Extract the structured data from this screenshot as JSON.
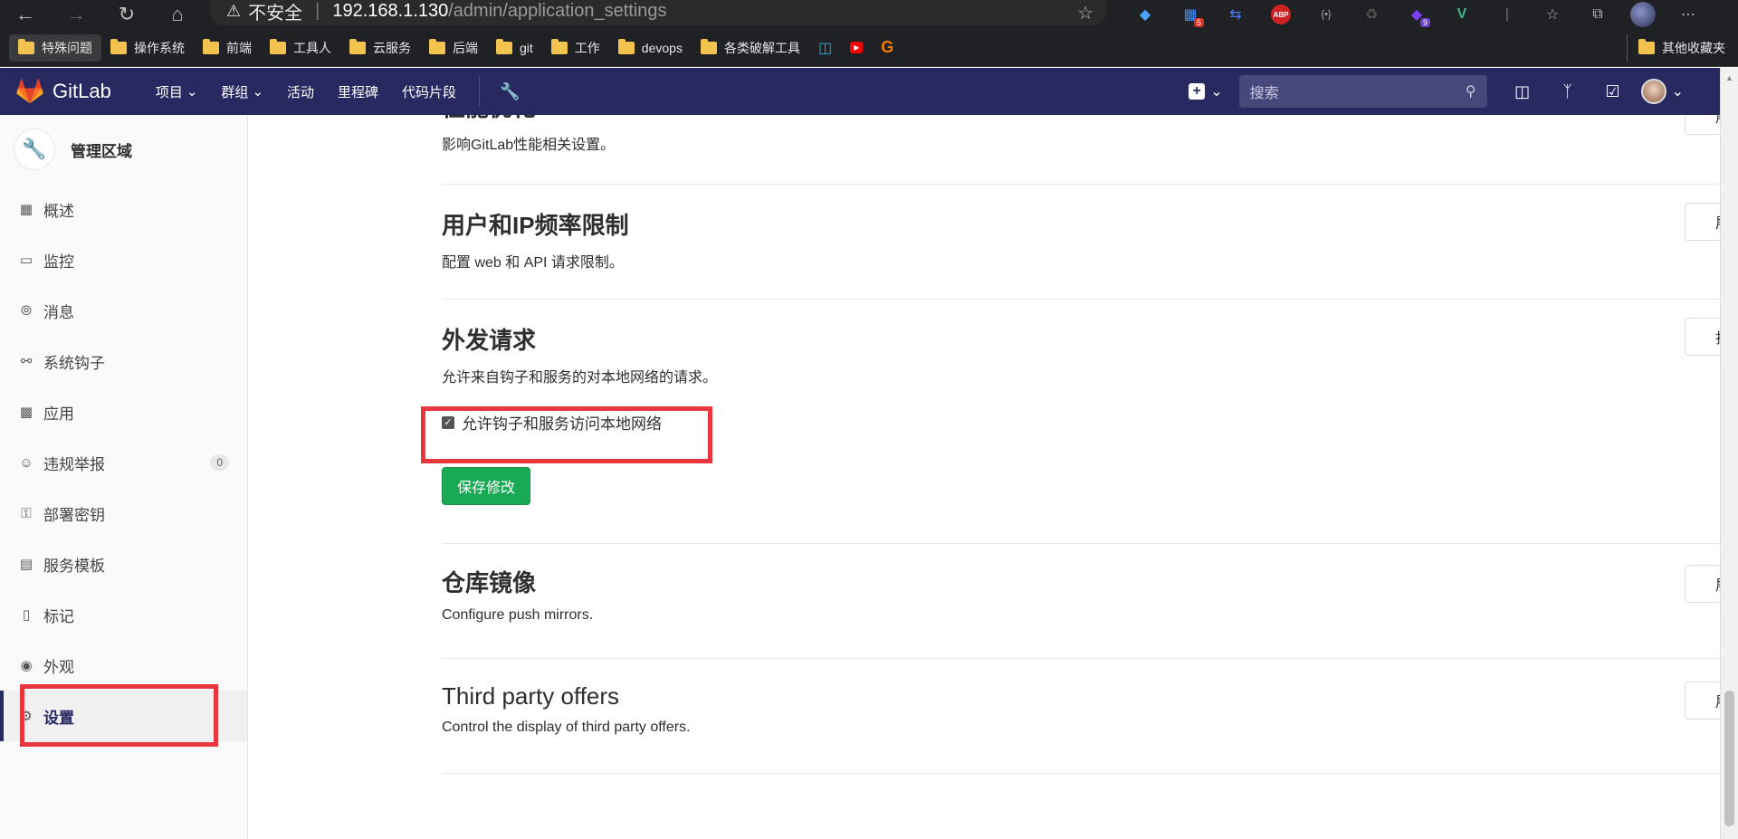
{
  "browser": {
    "security_label": "不安全",
    "url_host": "192.168.1.130",
    "url_path": "/admin/application_settings",
    "extensions": [
      {
        "name": "gem-icon",
        "badge": ""
      },
      {
        "name": "puzzle-icon",
        "badge": "5"
      },
      {
        "name": "repost-icon",
        "badge": ""
      },
      {
        "name": "adblock-icon",
        "badge": ""
      },
      {
        "name": "code-icon",
        "badge": ""
      },
      {
        "name": "recycle-icon",
        "badge": ""
      },
      {
        "name": "shape-icon",
        "badge": "9"
      },
      {
        "name": "vue-icon",
        "badge": ""
      }
    ],
    "bookmarks": [
      "特殊问题",
      "操作系统",
      "前端",
      "工具人",
      "云服务",
      "后端",
      "git",
      "工作",
      "devops",
      "各类破解工具"
    ],
    "other_bookmarks": "其他收藏夹"
  },
  "gitlab_nav": {
    "brand": "GitLab",
    "menu": [
      "项目",
      "群组",
      "活动",
      "里程碑",
      "代码片段"
    ],
    "search_placeholder": "搜索"
  },
  "sidebar": {
    "title": "管理区域",
    "items": [
      {
        "label": "概述",
        "icon": "grid-icon"
      },
      {
        "label": "监控",
        "icon": "monitor-icon"
      },
      {
        "label": "消息",
        "icon": "broadcast-icon"
      },
      {
        "label": "系统钩子",
        "icon": "hook-icon"
      },
      {
        "label": "应用",
        "icon": "apps-icon"
      },
      {
        "label": "违规举报",
        "icon": "smiley-icon",
        "count": "0"
      },
      {
        "label": "部署密钥",
        "icon": "key-icon"
      },
      {
        "label": "服务模板",
        "icon": "template-icon"
      },
      {
        "label": "标记",
        "icon": "label-icon"
      },
      {
        "label": "外观",
        "icon": "palette-icon"
      },
      {
        "label": "设置",
        "icon": "gear-icon",
        "active": true
      }
    ]
  },
  "main": {
    "partial_section": {
      "title": "性能优化",
      "desc": "影响GitLab性能相关设置。",
      "button": "展开"
    },
    "sections": [
      {
        "title": "用户和IP频率限制",
        "desc": "配置 web 和 API 请求限制。",
        "button": "展开"
      },
      {
        "title": "外发请求",
        "desc": "允许来自钩子和服务的对本地网络的请求。",
        "button": "折叠",
        "checkbox_label": "允许钩子和服务访问本地网络",
        "checkbox_checked": true,
        "save_label": "保存修改"
      },
      {
        "title": "仓库镜像",
        "desc": "Configure push mirrors.",
        "button": "展开"
      },
      {
        "title": "Third party offers",
        "desc": "Control the display of third party offers.",
        "button": "展开"
      }
    ]
  },
  "colors": {
    "navbar": "#292961",
    "save_button": "#1aaa55",
    "highlight": "#e8363f"
  }
}
